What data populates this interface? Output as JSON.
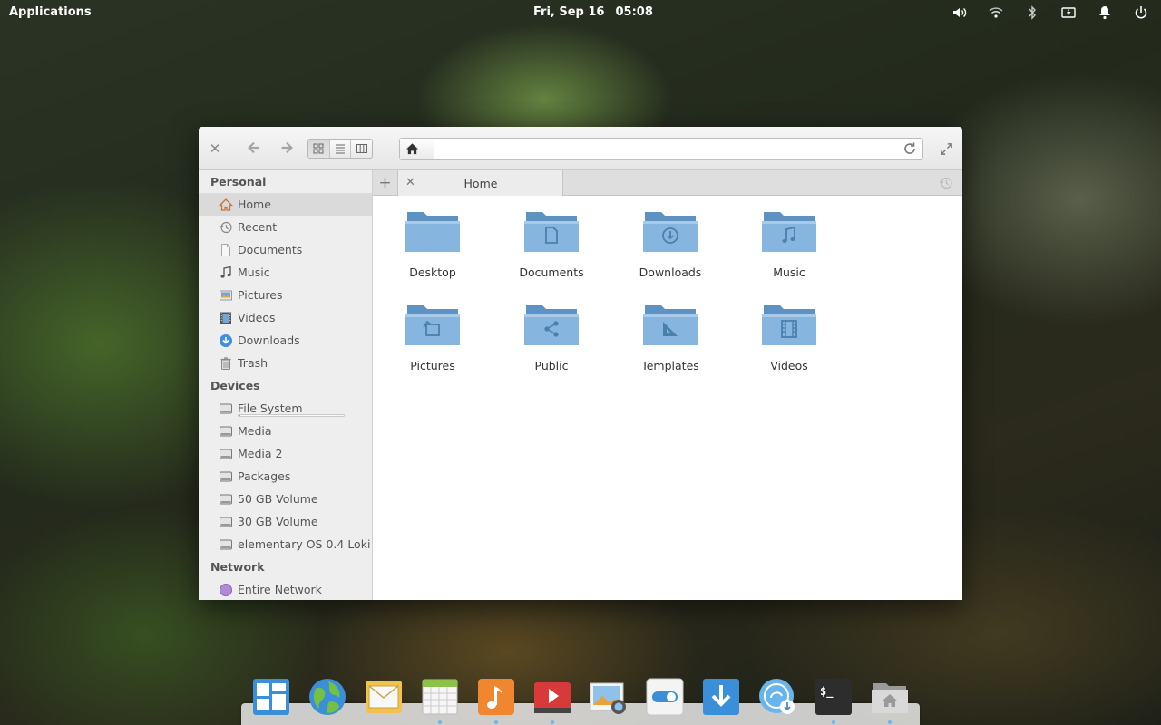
{
  "panel": {
    "applications_label": "Applications",
    "date": "Fri, Sep 16",
    "time": "05:08",
    "indicators": [
      "sound-icon",
      "wifi-icon",
      "bluetooth-icon",
      "battery-icon",
      "notifications-icon",
      "power-icon"
    ]
  },
  "window": {
    "headerbar": {
      "view_modes": [
        "icon-view",
        "list-view",
        "column-view"
      ],
      "active_view": "icon-view"
    },
    "tabs": [
      {
        "label": "Home",
        "active": true
      }
    ],
    "sidebar": {
      "sections": [
        {
          "title": "Personal",
          "items": [
            {
              "label": "Home",
              "icon": "home-icon",
              "selected": true
            },
            {
              "label": "Recent",
              "icon": "recent-icon"
            },
            {
              "label": "Documents",
              "icon": "document-icon"
            },
            {
              "label": "Music",
              "icon": "music-icon"
            },
            {
              "label": "Pictures",
              "icon": "pictures-icon"
            },
            {
              "label": "Videos",
              "icon": "videos-icon"
            },
            {
              "label": "Downloads",
              "icon": "downloads-icon"
            },
            {
              "label": "Trash",
              "icon": "trash-icon"
            }
          ]
        },
        {
          "title": "Devices",
          "items": [
            {
              "label": "File System",
              "icon": "drive-icon",
              "usage": 0.02
            },
            {
              "label": "Media",
              "icon": "drive-icon"
            },
            {
              "label": "Media 2",
              "icon": "drive-icon"
            },
            {
              "label": "Packages",
              "icon": "drive-icon"
            },
            {
              "label": "50 GB Volume",
              "icon": "drive-icon"
            },
            {
              "label": "30 GB Volume",
              "icon": "drive-icon"
            },
            {
              "label": "elementary OS 0.4 Loki",
              "icon": "drive-icon"
            }
          ]
        },
        {
          "title": "Network",
          "items": [
            {
              "label": "Entire Network",
              "icon": "network-icon"
            }
          ]
        }
      ]
    },
    "folders": [
      {
        "label": "Desktop",
        "emblem": "none"
      },
      {
        "label": "Documents",
        "emblem": "document"
      },
      {
        "label": "Downloads",
        "emblem": "download"
      },
      {
        "label": "Music",
        "emblem": "music"
      },
      {
        "label": "Pictures",
        "emblem": "pictures"
      },
      {
        "label": "Public",
        "emblem": "share"
      },
      {
        "label": "Templates",
        "emblem": "template"
      },
      {
        "label": "Videos",
        "emblem": "video"
      }
    ]
  },
  "dock": {
    "apps": [
      {
        "name": "multitasking-view-icon",
        "running": false
      },
      {
        "name": "web-browser-icon",
        "running": false
      },
      {
        "name": "mail-icon",
        "running": false
      },
      {
        "name": "calendar-icon",
        "running": true
      },
      {
        "name": "music-player-icon",
        "running": true
      },
      {
        "name": "videos-player-icon",
        "running": true
      },
      {
        "name": "photos-icon",
        "running": false
      },
      {
        "name": "system-settings-icon",
        "running": false
      },
      {
        "name": "appcenter-icon",
        "running": false
      },
      {
        "name": "software-update-icon",
        "running": false
      },
      {
        "name": "terminal-icon",
        "running": true
      },
      {
        "name": "files-icon",
        "running": true
      }
    ],
    "terminal_prompt": "$_"
  },
  "colors": {
    "folder_blue": "#7fb1dc",
    "folder_dark": "#5e92c2",
    "accent": "#3689e6"
  }
}
